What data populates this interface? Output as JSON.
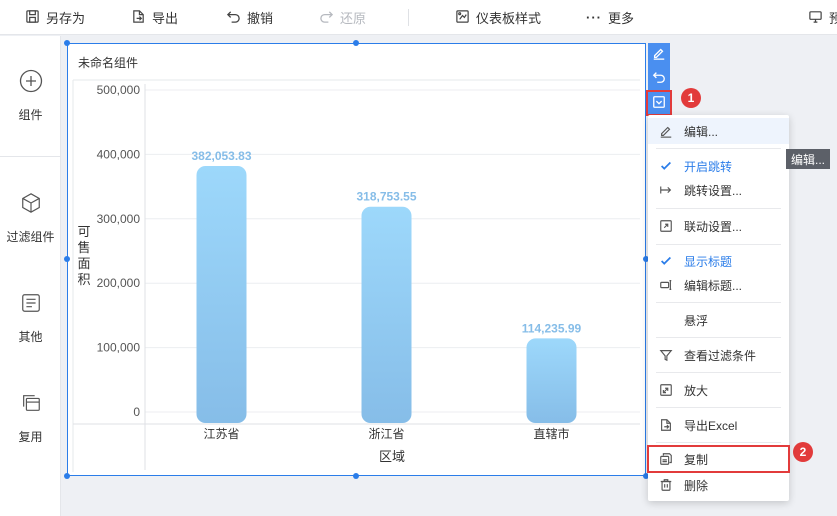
{
  "toolbar": {
    "save_as": "另存为",
    "export": "导出",
    "undo": "撤销",
    "redo": "还原",
    "dashboard_style": "仪表板样式",
    "more": "更多",
    "preview": "预"
  },
  "sidebar": {
    "items": [
      {
        "label": "组件",
        "icon": "plus-circle-icon"
      },
      {
        "label": "过滤组件",
        "icon": "cube-icon"
      },
      {
        "label": "其他",
        "icon": "text-box-icon"
      },
      {
        "label": "复用",
        "icon": "stacked-windows-icon"
      }
    ]
  },
  "widget": {
    "title": "未命名组件"
  },
  "chart_data": {
    "type": "bar",
    "categories": [
      "江苏省",
      "浙江省",
      "直辖市"
    ],
    "values": [
      382053.83,
      318753.55,
      114235.99
    ],
    "value_labels": [
      "382,053.83",
      "318,753.55",
      "114,235.99"
    ],
    "xlabel": "区域",
    "ylabel": "可售面积",
    "ylim": [
      0,
      500000
    ],
    "yticks": [
      0,
      100000,
      200000,
      300000,
      400000,
      500000
    ],
    "ytick_labels": [
      "0",
      "100,000",
      "200,000",
      "300,000",
      "400,000",
      "500,000"
    ],
    "grid": true,
    "bar_color_top": "#9dd8fb",
    "bar_color_bottom": "#86bde8",
    "label_color": "#86bde8"
  },
  "badges": [
    "1",
    "2"
  ],
  "menu": {
    "items": [
      {
        "label": "编辑...",
        "icon": "pencil-icon"
      },
      {
        "label": "开启跳转",
        "icon": "check-icon"
      },
      {
        "label": "跳转设置...",
        "icon": "jump-arrow-icon"
      },
      {
        "label": "联动设置...",
        "icon": "link-windows-icon"
      },
      {
        "label": "显示标题",
        "icon": "check-icon"
      },
      {
        "label": "编辑标题...",
        "icon": "title-edit-icon"
      },
      {
        "label": "悬浮",
        "icon": ""
      },
      {
        "label": "查看过滤条件",
        "icon": "filter-icon"
      },
      {
        "label": "放大",
        "icon": "expand-icon"
      },
      {
        "label": "导出Excel",
        "icon": "export-doc-icon"
      },
      {
        "label": "复制",
        "icon": "copy-icon"
      },
      {
        "label": "删除",
        "icon": "trash-icon"
      }
    ]
  },
  "tooltip": "编辑...",
  "colors": {
    "accent": "#2b7de9",
    "highlight": "#e23b3b"
  }
}
